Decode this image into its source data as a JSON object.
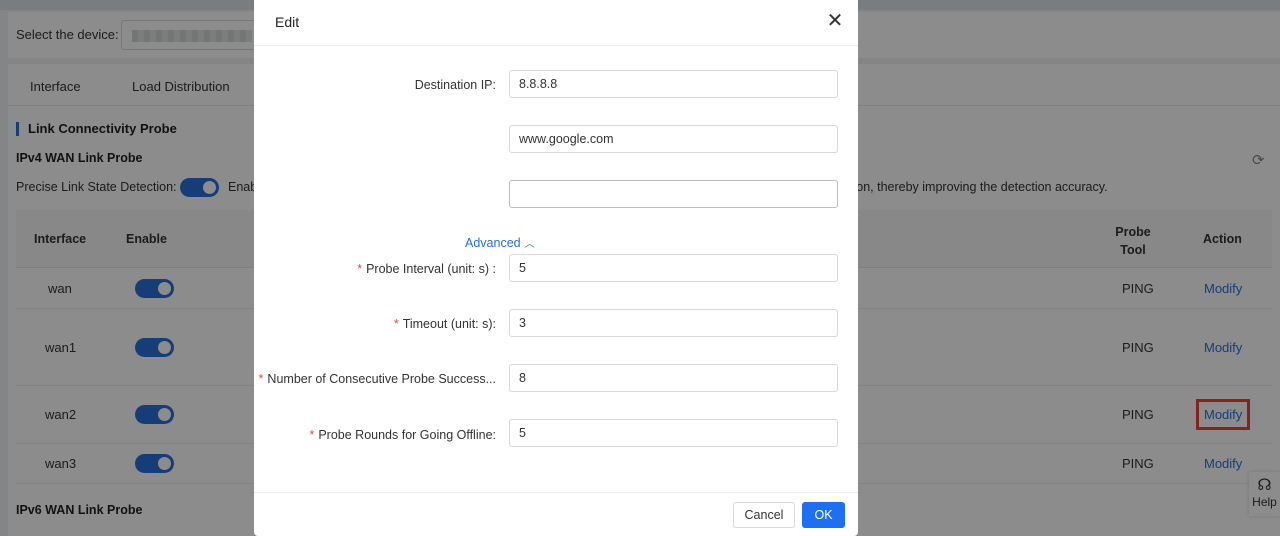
{
  "page": {
    "device_label": "Select the device:",
    "tabs": [
      "Interface",
      "Load Distribution"
    ],
    "section_title": "Link Connectivity Probe",
    "ipv4_title": "IPv4 WAN Link Probe",
    "ipv6_title": "IPv6 WAN Link Probe",
    "precise_label": "Precise Link State Detection:",
    "precise_tail": "Enab",
    "precise_tail2": "tion, thereby improving the detection accuracy.",
    "precise_enabled": true,
    "table": {
      "headers": {
        "interface": "Interface",
        "enable": "Enable",
        "probe_tool": "Probe Tool",
        "action": "Action"
      },
      "rows": [
        {
          "interface": "wan",
          "enabled": true,
          "probe_tool": "PING",
          "action": "Modify"
        },
        {
          "interface": "wan1",
          "enabled": true,
          "probe_tool": "PING",
          "action": "Modify"
        },
        {
          "interface": "wan2",
          "enabled": true,
          "probe_tool": "PING",
          "action": "Modify"
        },
        {
          "interface": "wan3",
          "enabled": true,
          "probe_tool": "PING",
          "action": "Modify"
        }
      ]
    },
    "help_label": "Help"
  },
  "modal": {
    "title": "Edit",
    "close_icon": "close-icon",
    "fields": {
      "destination_ip": {
        "label": "Destination IP:",
        "value": "8.8.8.8"
      },
      "destination_2": {
        "value": "www.google.com"
      },
      "destination_3": {
        "value": ""
      },
      "advanced_label": "Advanced",
      "probe_interval": {
        "label": "Probe Interval (unit: s) :",
        "value": "5",
        "required": true
      },
      "timeout": {
        "label": "Timeout (unit: s):",
        "value": "3",
        "required": true
      },
      "consecutive_success": {
        "label": "Number of Consecutive Probe Success...",
        "value": "8",
        "required": true
      },
      "rounds_offline": {
        "label": "Probe Rounds for Going Offline:",
        "value": "5",
        "required": true
      }
    },
    "buttons": {
      "cancel": "Cancel",
      "ok": "OK"
    }
  },
  "colors": {
    "primary": "#1e6ff2",
    "link": "#2a6fdb",
    "required": "#e5483c",
    "highlight": "#e8463a"
  }
}
